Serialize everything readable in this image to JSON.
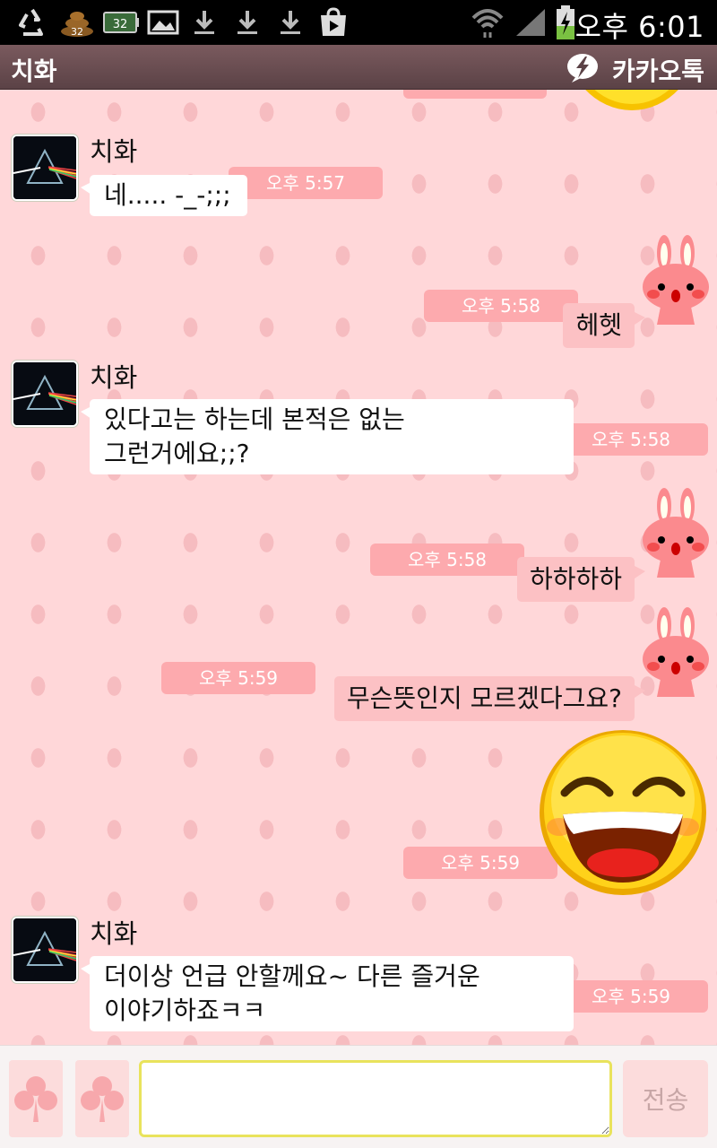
{
  "status_bar": {
    "icons": [
      "recycle-icon",
      "poop-icon",
      "battery-32-icon",
      "gallery-icon",
      "download-icon",
      "download-icon",
      "download-icon",
      "play-store-icon",
      "wifi-icon",
      "signal-icon",
      "battery-charging-icon"
    ],
    "badge_poop": "32",
    "badge_battery": "32",
    "time": "오후 6:01"
  },
  "header": {
    "title": "치화",
    "brand": "카카오톡",
    "color": "#6b4e52"
  },
  "colors": {
    "chat_bg": "#ffd7d9",
    "outgoing_bubble": "#fcc1c4",
    "timestamp_bg": "#fdaaae",
    "input_border": "#e9e35c"
  },
  "messages": [
    {
      "sender": "치화",
      "text": "네..... -_-;;;",
      "time": "오후 5:57"
    },
    {
      "text": "헤헷",
      "time": "오후 5:58"
    },
    {
      "sender": "치화",
      "text": "있다고는 하는데 본적은 없는\n그런거에요;;?",
      "time": "오후 5:58"
    },
    {
      "text": "하하하하",
      "time": "오후 5:58"
    },
    {
      "text": "무슨뜻인지 모르겠다그요?",
      "time": "오후 5:59"
    },
    {
      "emoticon": "laughing-face",
      "time": "오후 5:59"
    },
    {
      "sender": "치화",
      "text": "더이상 언급 안할께요~ 다른 즐거운\n이야기하죠ㅋㅋ",
      "time": "오후 5:59"
    }
  ],
  "input": {
    "placeholder": "",
    "send_label": "전송"
  }
}
